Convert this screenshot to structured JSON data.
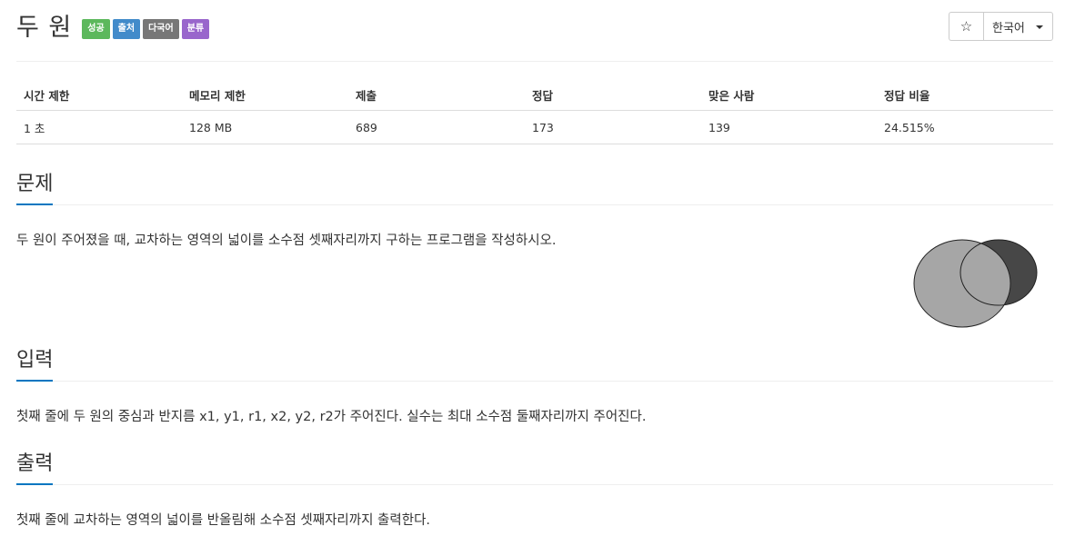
{
  "header": {
    "title": "두 원",
    "badges": [
      {
        "label": "성공",
        "color": "#5cb85c"
      },
      {
        "label": "출처",
        "color": "#428bca"
      },
      {
        "label": "다국어",
        "color": "#777777"
      },
      {
        "label": "분류",
        "color": "#9966cc"
      }
    ],
    "star_icon": "star-outline-icon",
    "star_glyph": "☆",
    "language_label": "한국어"
  },
  "info": {
    "headers": [
      "시간 제한",
      "메모리 제한",
      "제출",
      "정답",
      "맞은 사람",
      "정답 비율"
    ],
    "values": [
      "1 초",
      "128 MB",
      "689",
      "173",
      "139",
      "24.515%"
    ]
  },
  "problem": {
    "heading": "문제",
    "text": "두 원이 주어졌을 때, 교차하는 영역의 넓이를 소수점 셋째자리까지 구하는 프로그램을 작성하시오."
  },
  "input": {
    "heading": "입력",
    "text": "첫째 줄에 두 원의 중심과 반지름 x1, y1, r1, x2, y2, r2가 주어진다. 실수는 최대 소수점 둘째자리까지 주어진다."
  },
  "output": {
    "heading": "출력",
    "text": "첫째 줄에 교차하는 영역의 넓이를 반올림해 소수점 셋째자리까지 출력한다."
  },
  "colors": {
    "accent": "#0076c0",
    "circle_left": "#a6a6a6",
    "circle_right": "#474747",
    "intersection": "#a0a0a0"
  }
}
